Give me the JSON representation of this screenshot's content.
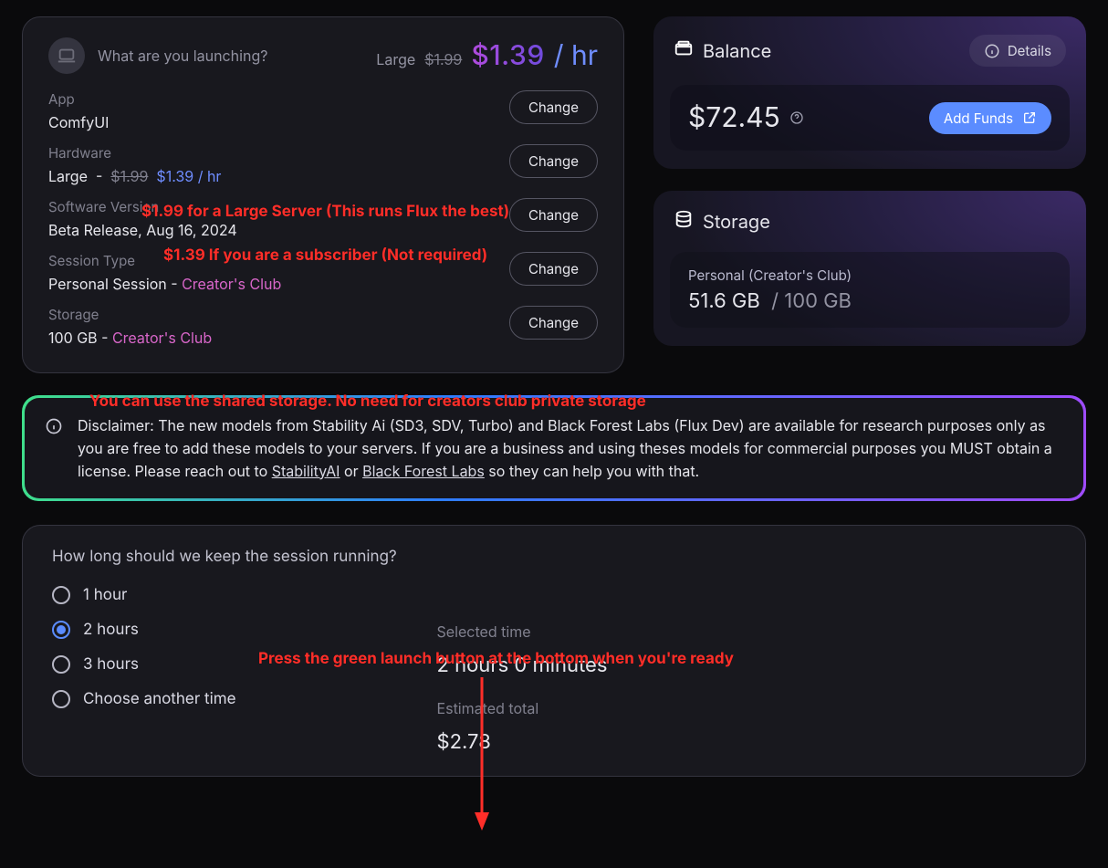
{
  "launch": {
    "heading": "What are you launching?",
    "plan": "Large",
    "original_price": "$1.99",
    "price": "$1.39",
    "per": "/ hr",
    "change": "Change",
    "fields": {
      "app": {
        "label": "App",
        "value": "ComfyUI"
      },
      "hw": {
        "label": "Hardware",
        "size": "Large",
        "sep": "-",
        "orig": "$1.99",
        "now": "$1.39",
        "per": "/ hr"
      },
      "sw": {
        "label": "Software Version",
        "value": "Beta Release, Aug 16, 2024"
      },
      "sess": {
        "label": "Session Type",
        "value": "Personal Session -",
        "suffix": "Creator's Club"
      },
      "stor": {
        "label": "Storage",
        "value": "100 GB -",
        "suffix": "Creator's Club"
      }
    }
  },
  "balance": {
    "title": "Balance",
    "details": "Details",
    "amount": "$72.45",
    "add_funds": "Add Funds"
  },
  "storage": {
    "title": "Storage",
    "plan": "Personal (Creator's Club)",
    "used": "51.6 GB",
    "sep": "/",
    "total": "100 GB"
  },
  "disclaimer": {
    "text_a": "Disclaimer: The new models from Stability Ai (SD3, SDV, Turbo) and Black Forest Labs (Flux Dev) are available for research purposes only as you are free to add these models to your servers. If you are a business and using theses models for commercial purposes you MUST obtain a license. Please reach out to ",
    "link1": "StabilityAI",
    "mid": " or ",
    "link2": "Black Forest Labs",
    "text_b": " so they can help you with that."
  },
  "duration": {
    "question": "How long should we keep the session running?",
    "options": [
      "1 hour",
      "2 hours",
      "3 hours",
      "Choose another time"
    ],
    "selected_index": 1,
    "summary": {
      "sel_label": "Selected time",
      "sel_value": "2 hours 0 minutes",
      "tot_label": "Estimated total",
      "tot_value": "$2.78"
    }
  },
  "anno": {
    "a1": "$1.99 for a Large Server (This runs Flux the best)",
    "a2": "$1.39 If you are a subscriber (Not required)",
    "a3": "You can use the shared storage. No need for creators club private storage",
    "a4": "Press the green launch button at the bottom when you're ready"
  }
}
